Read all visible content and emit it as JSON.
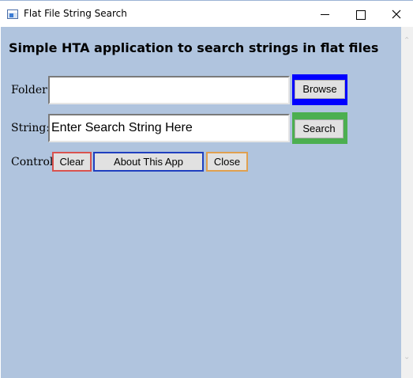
{
  "window": {
    "title": "Flat File String Search"
  },
  "main": {
    "heading": "Simple HTA application to search strings in flat files",
    "folder_label": "Folder:",
    "folder_value": "",
    "browse_label": "Browse",
    "string_label": "String:",
    "string_value": "Enter Search String Here",
    "search_label": "Search",
    "control_label": "Control:",
    "clear_label": "Clear",
    "about_label": "About This App",
    "close_label": "Close"
  },
  "colors": {
    "client_background": "#b0c4de",
    "browse_frame": "#0000ff",
    "search_frame": "#4caf50",
    "clear_border": "#d9534f",
    "about_border": "#1f3fbf",
    "close_border": "#e0a050"
  },
  "icons": {
    "app": "window-icon",
    "minimize": "minimize-icon",
    "maximize": "maximize-icon",
    "close": "close-icon",
    "scroll_up": "chevron-up-icon",
    "scroll_down": "chevron-down-icon"
  }
}
